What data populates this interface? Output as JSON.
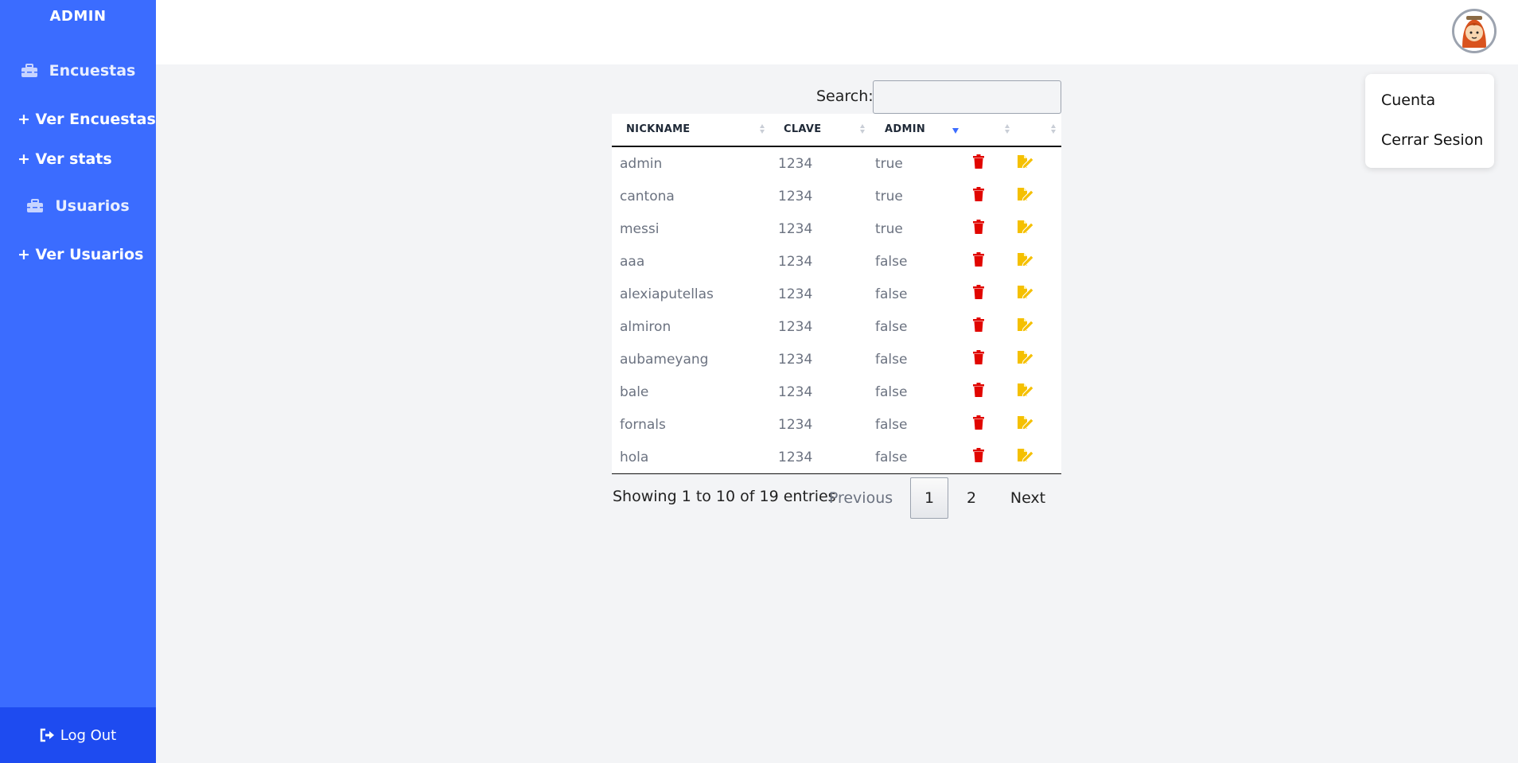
{
  "sidebar": {
    "brand": "ADMIN",
    "sections": [
      {
        "label": "Encuestas",
        "icon": "toolbox-icon"
      },
      {
        "label": "Usuarios",
        "icon": "toolbox-icon"
      }
    ],
    "links": [
      "+ Ver Encuestas",
      "+ Ver stats",
      "+ Ver Usuarios"
    ],
    "logout": "Log Out"
  },
  "user_menu": {
    "items": [
      "Cuenta",
      "Cerrar Sesion"
    ]
  },
  "table": {
    "search_label": "Search:",
    "search_value": "",
    "columns": [
      "NICKNAME",
      "CLAVE",
      "ADMIN",
      "",
      ""
    ],
    "sorted_column": "ADMIN",
    "rows": [
      {
        "nickname": "admin",
        "clave": "1234",
        "admin": "true"
      },
      {
        "nickname": "cantona",
        "clave": "1234",
        "admin": "true"
      },
      {
        "nickname": "messi",
        "clave": "1234",
        "admin": "true"
      },
      {
        "nickname": "aaa",
        "clave": "1234",
        "admin": "false"
      },
      {
        "nickname": "alexiaputellas",
        "clave": "1234",
        "admin": "false"
      },
      {
        "nickname": "almiron",
        "clave": "1234",
        "admin": "false"
      },
      {
        "nickname": "aubameyang",
        "clave": "1234",
        "admin": "false"
      },
      {
        "nickname": "bale",
        "clave": "1234",
        "admin": "false"
      },
      {
        "nickname": "fornals",
        "clave": "1234",
        "admin": "false"
      },
      {
        "nickname": "hola",
        "clave": "1234",
        "admin": "false"
      }
    ],
    "info": "Showing 1 to 10 of 19 entries",
    "pagination": {
      "previous": "Previous",
      "pages": [
        "1",
        "2"
      ],
      "current": "1",
      "next": "Next"
    }
  },
  "colors": {
    "sidebar": "#3b6cff",
    "logout_bar": "#1e4bf0",
    "delete_icon": "#e10600",
    "edit_icon": "#f5c000",
    "background": "#f3f4f6"
  }
}
